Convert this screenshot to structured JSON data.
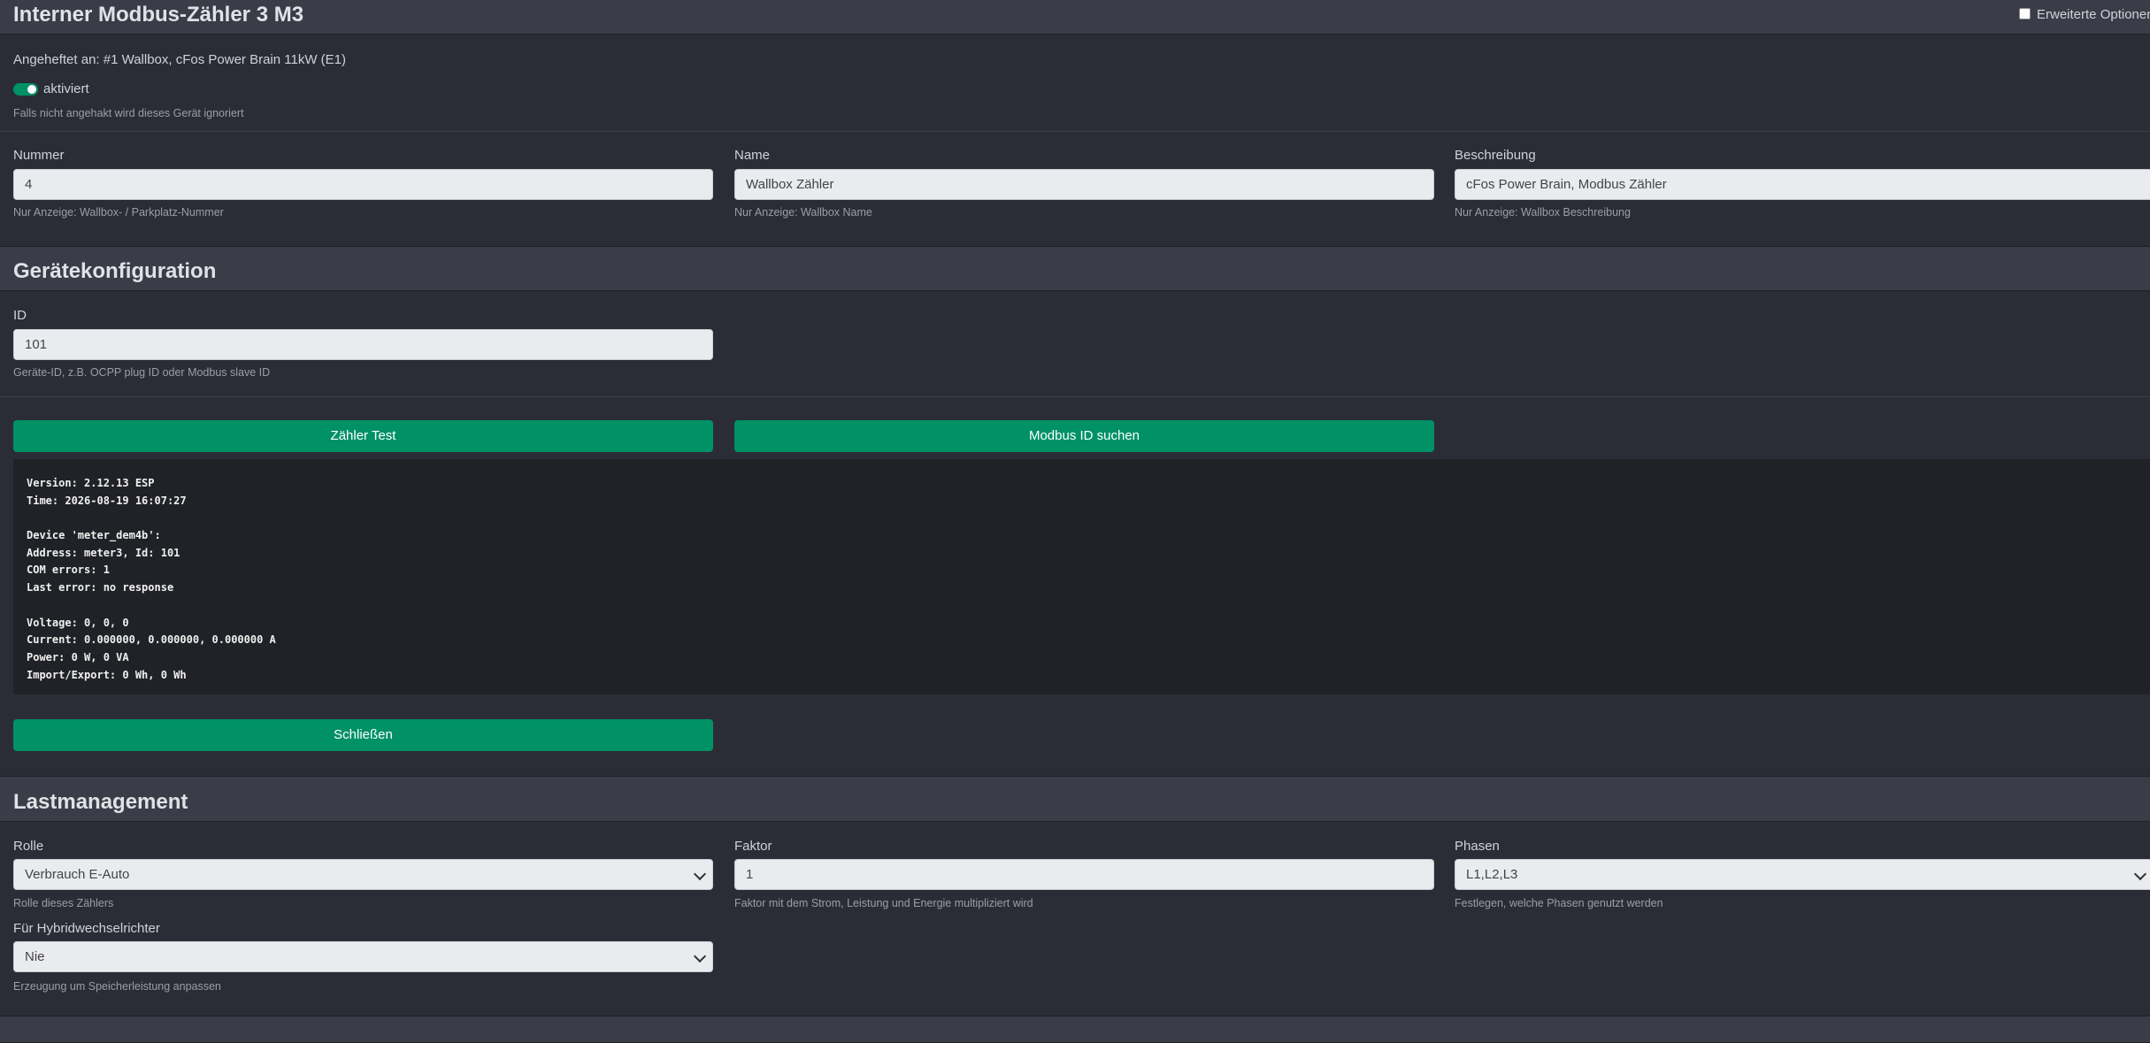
{
  "header": {
    "title": "Interner Modbus-Zähler 3 M3",
    "advanced_options_label": "Erweiterte Optionen"
  },
  "general": {
    "attached_to": "Angeheftet an: #1 Wallbox, cFos Power Brain 11kW (E1)",
    "activated_label": "aktiviert",
    "activated_hint": "Falls nicht angehakt wird dieses Gerät ignoriert",
    "number_label": "Nummer",
    "number_value": "4",
    "number_hint": "Nur Anzeige: Wallbox- / Parkplatz-Nummer",
    "name_label": "Name",
    "name_value": "Wallbox Zähler",
    "name_hint": "Nur Anzeige: Wallbox Name",
    "description_label": "Beschreibung",
    "description_value": "cFos Power Brain, Modbus Zähler",
    "description_hint": "Nur Anzeige: Wallbox Beschreibung"
  },
  "device_config": {
    "title": "Gerätekonfiguration",
    "id_label": "ID",
    "id_value": "101",
    "id_hint": "Geräte-ID, z.B. OCPP plug ID oder Modbus slave ID",
    "meter_test_button": "Zähler Test",
    "modbus_search_button": "Modbus ID suchen",
    "console_lines": [
      "Version: 2.12.13 ESP",
      "Time: 2026-08-19 16:07:27",
      "",
      "Device 'meter_dem4b':",
      "Address: meter3, Id: 101",
      "COM errors: 1",
      "Last error: no response",
      "",
      "Voltage: 0, 0, 0",
      "Current: 0.000000, 0.000000, 0.000000 A",
      "Power: 0 W, 0 VA",
      "Import/Export: 0 Wh, 0 Wh"
    ],
    "close_button": "Schließen"
  },
  "load_management": {
    "title": "Lastmanagement",
    "role_label": "Rolle",
    "role_value": "Verbrauch E-Auto",
    "role_hint": "Rolle dieses Zählers",
    "factor_label": "Faktor",
    "factor_value": "1",
    "factor_hint": "Faktor mit dem Strom, Leistung und Energie multipliziert wird",
    "phases_label": "Phasen",
    "phases_value": "L1,L2,L3",
    "phases_hint": "Festlegen, welche Phasen genutzt werden",
    "hybrid_label": "Für Hybridwechselrichter",
    "hybrid_value": "Nie",
    "hybrid_hint": "Erzeugung um Speicherleistung anpassen"
  },
  "colors": {
    "accent": "#009166",
    "background": "#2b2d36",
    "section_header": "#3a3d48",
    "console": "#202227"
  }
}
